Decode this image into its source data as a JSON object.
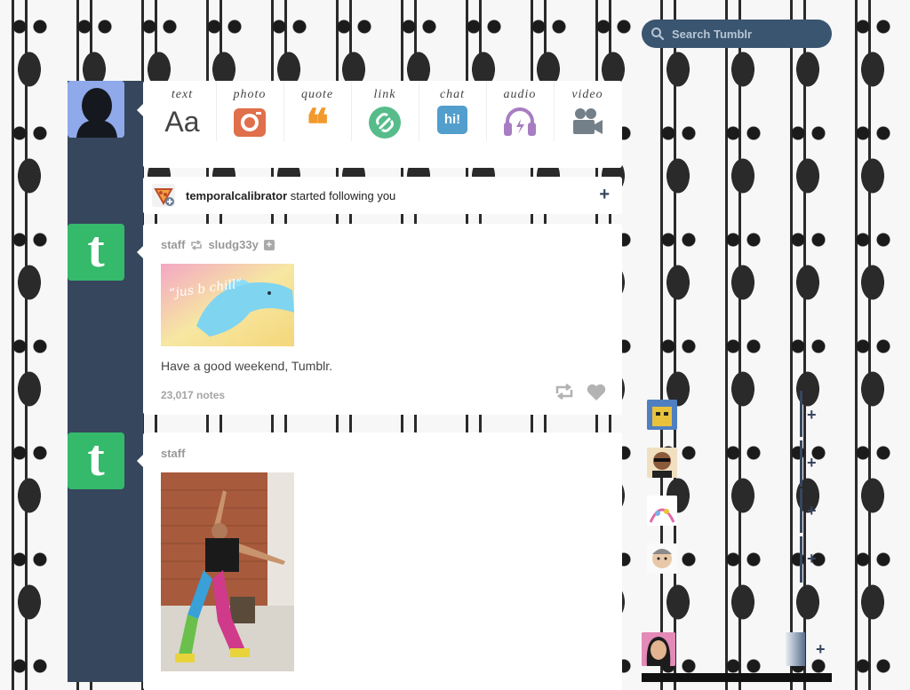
{
  "search": {
    "placeholder": "Search Tumblr"
  },
  "post_types": [
    {
      "label": "text",
      "glyph": "Aa",
      "icon": "text-icon",
      "color": "#444444"
    },
    {
      "label": "photo",
      "icon": "camera-icon",
      "color": "#e06f4b"
    },
    {
      "label": "quote",
      "glyph": "❝",
      "icon": "quote-icon",
      "color": "#f2992e"
    },
    {
      "label": "link",
      "icon": "link-icon",
      "color": "#56bc8a"
    },
    {
      "label": "chat",
      "glyph": "hi!",
      "icon": "chat-icon",
      "color": "#529ecc"
    },
    {
      "label": "audio",
      "icon": "headphones-icon",
      "color": "#a77dc2"
    },
    {
      "label": "video",
      "icon": "video-camera-icon",
      "color": "#748089"
    }
  ],
  "activity": {
    "username": "temporalcalibrator",
    "text": " started following you",
    "action_icon": "plus-icon"
  },
  "posts": [
    {
      "author": "staff",
      "reblogged_from": "sludg33y",
      "image_text": "“jus b chill”",
      "caption": "Have a good weekend, Tumblr.",
      "notes": "23,017 notes"
    },
    {
      "author": "staff"
    }
  ],
  "sidebar": {
    "plus": "+"
  },
  "colors": {
    "dashboard_blue": "#36465d",
    "tumblr_green": "#35b96b",
    "search_bg": "#3a5570"
  }
}
